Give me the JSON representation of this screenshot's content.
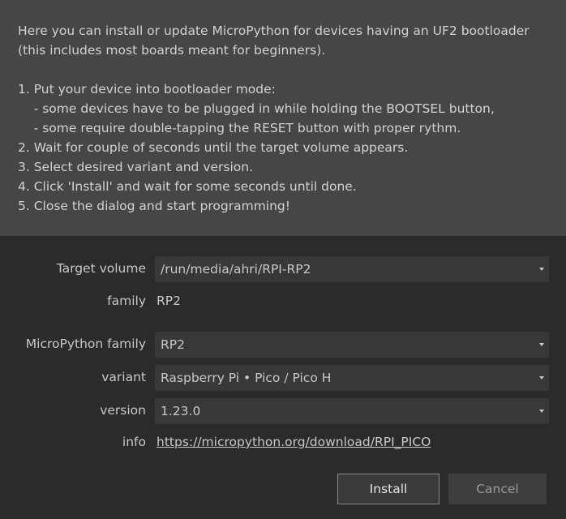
{
  "intro": {
    "lines": [
      "Here you can install or update MicroPython for devices having an UF2 bootloader",
      "(this includes most boards meant for beginners).",
      "1. Put your device into bootloader mode:",
      "    - some devices have to be plugged in while holding the BOOTSEL button,",
      "    - some require double-tapping the RESET button with proper rythm.",
      "2. Wait for couple of seconds until the target volume appears.",
      "3. Select desired variant and version.",
      "4. Click 'Install' and wait for some seconds until done.",
      "5. Close the dialog and start programming!"
    ]
  },
  "form": {
    "target_volume_label": "Target volume",
    "target_volume_value": "/run/media/ahri/RPI-RP2",
    "family_label": "family",
    "family_value": "RP2",
    "mp_family_label": "MicroPython family",
    "mp_family_value": "RP2",
    "variant_label": "variant",
    "variant_value": "Raspberry Pi • Pico / Pico H",
    "version_label": "version",
    "version_value": "1.23.0",
    "info_label": "info",
    "info_link": "https://micropython.org/download/RPI_PICO"
  },
  "buttons": {
    "install": "Install",
    "cancel": "Cancel"
  },
  "colors": {
    "intro_bg": "#464646",
    "dialog_bg": "#2b2b2b",
    "combo_bg": "#383838",
    "text": "#c8c8c8"
  },
  "icons": {
    "combo_arrow": "chevron-down-icon"
  }
}
